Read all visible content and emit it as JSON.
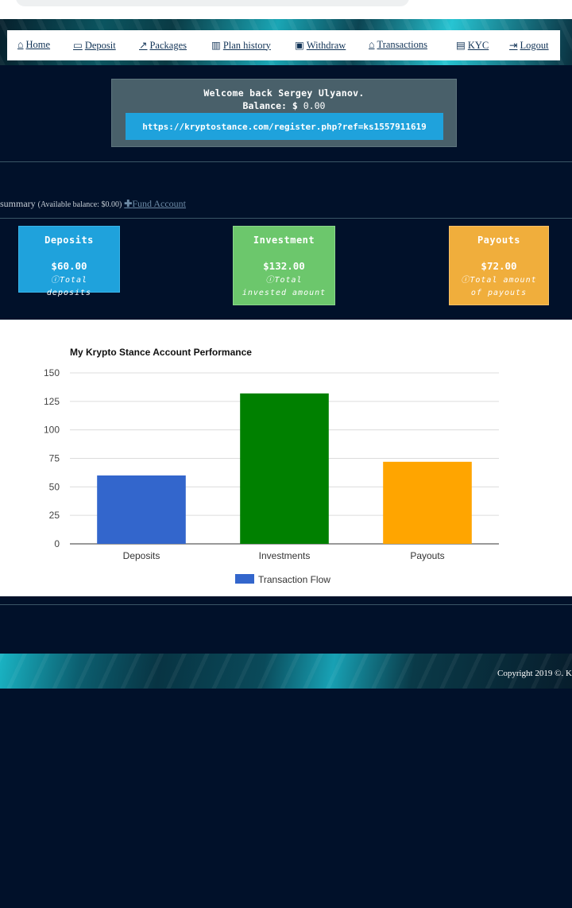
{
  "nav": {
    "items": [
      {
        "label": "Home",
        "icon": "home-icon",
        "glyph": "⌂"
      },
      {
        "label": "Deposit",
        "icon": "credit-card-icon",
        "glyph": "▭"
      },
      {
        "label": "Packages",
        "icon": "line-chart-icon",
        "glyph": "↗"
      },
      {
        "label": "Plan history",
        "icon": "bar-chart-icon",
        "glyph": "▥"
      },
      {
        "label": "Withdraw",
        "icon": "money-icon",
        "glyph": "▣"
      },
      {
        "label": "Transactions",
        "icon": "bank-icon",
        "glyph": "⌂"
      },
      {
        "label": "KYC",
        "icon": "id-card-icon",
        "glyph": "▤"
      },
      {
        "label": "Logout",
        "icon": "sign-out-icon",
        "glyph": "⇥"
      }
    ]
  },
  "welcome": {
    "greeting": "Welcome back Sergey Ulyanov.",
    "balance_label": "Balance:",
    "currency": "$",
    "balance_value": "0.00",
    "referral_link": "https://kryptostance.com/register.php?ref=ks1557911619"
  },
  "summary": {
    "label": "summary",
    "available": "(Available balance: $0.00)",
    "fund_label": "Fund Account"
  },
  "cards": {
    "deposits": {
      "title": "Deposits",
      "amount": "$60.00",
      "subtitle": "Total deposits",
      "color": "#1fa2dc"
    },
    "investment": {
      "title": "Investment",
      "amount": "$132.00",
      "subtitle": "Total invested amount",
      "color": "#6cc76c"
    },
    "payouts": {
      "title": "Payouts",
      "amount": "$72.00",
      "subtitle": "Total amount of payouts",
      "color": "#f0ae3c"
    }
  },
  "chart_data": {
    "type": "bar",
    "title": "My Krypto Stance Account Performance",
    "categories": [
      "Deposits",
      "Investments",
      "Payouts"
    ],
    "series": [
      {
        "name": "Transaction Flow",
        "values": [
          60,
          132,
          72
        ]
      }
    ],
    "bar_colors": [
      "#3366cc",
      "#008000",
      "#ffa500"
    ],
    "legend_color": "#3366cc",
    "yticks": [
      0,
      25,
      50,
      75,
      100,
      125,
      150
    ],
    "ylim": [
      0,
      150
    ],
    "grid": true,
    "legend_position": "bottom"
  },
  "footer": {
    "copyright": "Copyright 2019 ©. K"
  }
}
